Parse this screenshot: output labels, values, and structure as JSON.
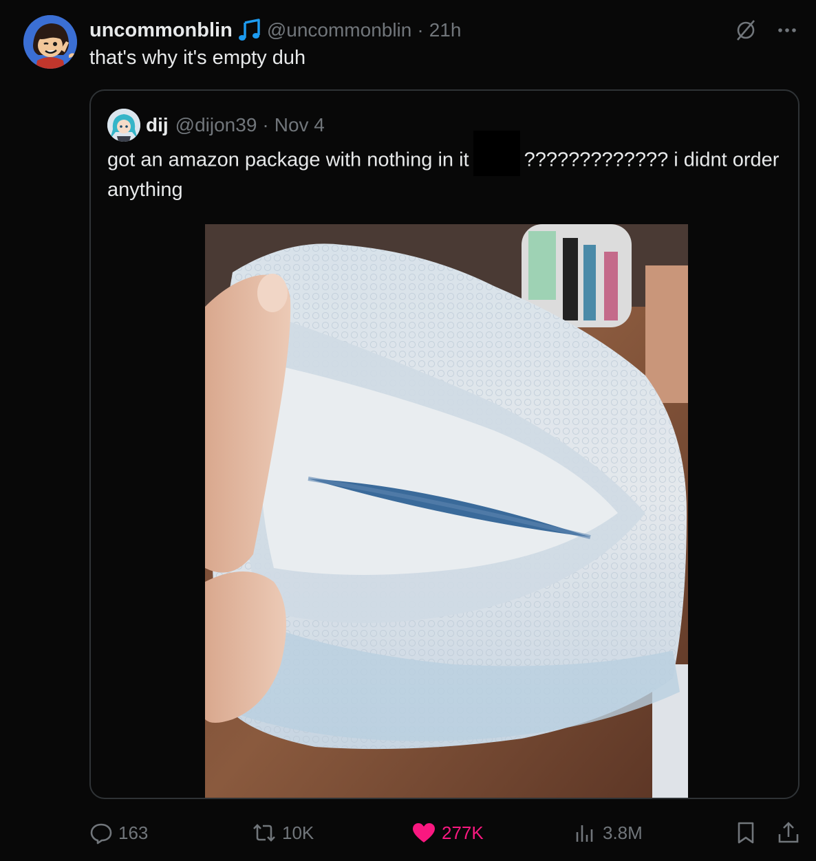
{
  "author": {
    "display_name": "uncommonblin",
    "handle": "@uncommonblin",
    "separator": "·",
    "time": "21h",
    "badge_icon": "music-note-icon"
  },
  "tweet": {
    "text": "that's why it's empty duh"
  },
  "quoted": {
    "display_name": "dij",
    "handle": "@dijon39",
    "separator": "·",
    "date": "Nov 4",
    "text_before": "got an amazon package with nothing in it",
    "text_after": "????????????? i didnt order anything",
    "media_description_icon": "photo"
  },
  "actions": {
    "replies": "163",
    "reposts": "10K",
    "likes": "277K",
    "views": "3.8M"
  },
  "colors": {
    "background": "#080808",
    "text": "#e7e9ea",
    "muted": "#71767b",
    "border": "#2f3336",
    "like": "#f91880",
    "accent": "#1d9bf0"
  }
}
